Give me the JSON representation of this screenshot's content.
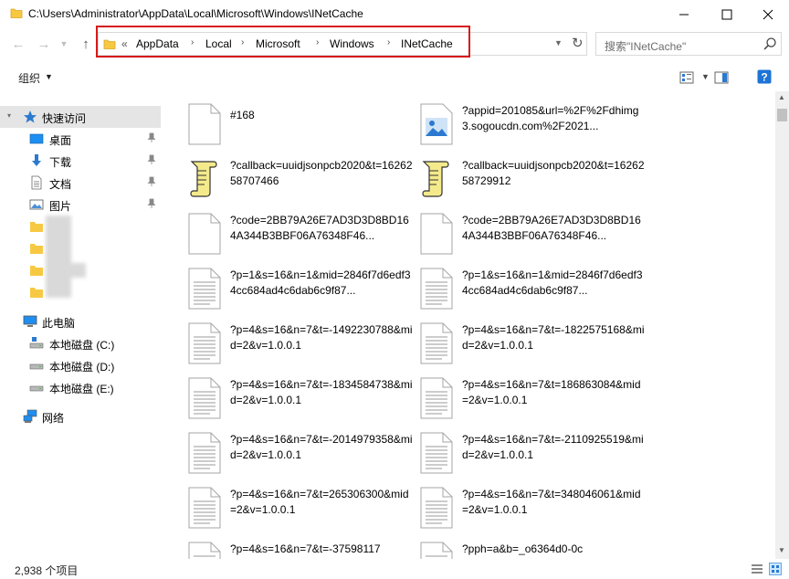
{
  "window": {
    "title": "C:\\Users\\Administrator\\AppData\\Local\\Microsoft\\Windows\\INetCache"
  },
  "address": {
    "overflow": "«",
    "crumbs": [
      "AppData",
      "Local",
      "Microsoft",
      "Windows",
      "INetCache"
    ]
  },
  "search": {
    "placeholder": "搜索\"INetCache\""
  },
  "toolbar": {
    "organize_label": "组织"
  },
  "nav": {
    "quick_access": "快速访问",
    "desktop": "桌面",
    "downloads": "下载",
    "documents": "文档",
    "pictures": "图片",
    "this_pc": "此电脑",
    "drive_c": "本地磁盘 (C:)",
    "drive_d": "本地磁盘 (D:)",
    "drive_e": "本地磁盘 (E:)",
    "network": "网络"
  },
  "files": [
    {
      "name": "#168",
      "icon": "blank-file-icon"
    },
    {
      "name": "?appid=201085&url=%2F%2Fdhimg3.sogoucdn.com%2F2021...",
      "icon": "image-file-icon"
    },
    {
      "name": "?callback=uuidjsonpcb2020&t=1626258707466",
      "icon": "script-file-icon"
    },
    {
      "name": "?callback=uuidjsonpcb2020&t=1626258729912",
      "icon": "script-file-icon"
    },
    {
      "name": "?code=2BB79A26E7AD3D3D8BD164A344B3BBF06A76348F46...",
      "icon": "blank-file-icon"
    },
    {
      "name": "?code=2BB79A26E7AD3D3D8BD164A344B3BBF06A76348F46...",
      "icon": "blank-file-icon"
    },
    {
      "name": "?p=1&s=16&n=1&mid=2846f7d6edf34cc684ad4c6dab6c9f87...",
      "icon": "text-file-icon"
    },
    {
      "name": "?p=1&s=16&n=1&mid=2846f7d6edf34cc684ad4c6dab6c9f87...",
      "icon": "text-file-icon"
    },
    {
      "name": "?p=4&s=16&n=7&t=-1492230788&mid=2&v=1.0.0.1",
      "icon": "text-file-icon"
    },
    {
      "name": "?p=4&s=16&n=7&t=-1822575168&mid=2&v=1.0.0.1",
      "icon": "text-file-icon"
    },
    {
      "name": "?p=4&s=16&n=7&t=-1834584738&mid=2&v=1.0.0.1",
      "icon": "text-file-icon"
    },
    {
      "name": "?p=4&s=16&n=7&t=186863084&mid=2&v=1.0.0.1",
      "icon": "text-file-icon"
    },
    {
      "name": "?p=4&s=16&n=7&t=-2014979358&mid=2&v=1.0.0.1",
      "icon": "text-file-icon"
    },
    {
      "name": "?p=4&s=16&n=7&t=-2110925519&mid=2&v=1.0.0.1",
      "icon": "text-file-icon"
    },
    {
      "name": "?p=4&s=16&n=7&t=265306300&mid=2&v=1.0.0.1",
      "icon": "text-file-icon"
    },
    {
      "name": "?p=4&s=16&n=7&t=348046061&mid=2&v=1.0.0.1",
      "icon": "text-file-icon"
    },
    {
      "name": "?p=4&s=16&n=7&t=-37598117",
      "icon": "text-file-icon"
    },
    {
      "name": "?pph=a&b=_o6364d0-0c",
      "icon": "text-file-icon"
    }
  ],
  "status": {
    "item_count": "2,938 个项目"
  },
  "colors": {
    "selection": "#cce8ff",
    "highlight_border": "#d71a1a",
    "folder_yellow": "#f7c942",
    "accent_blue": "#0078d7"
  }
}
